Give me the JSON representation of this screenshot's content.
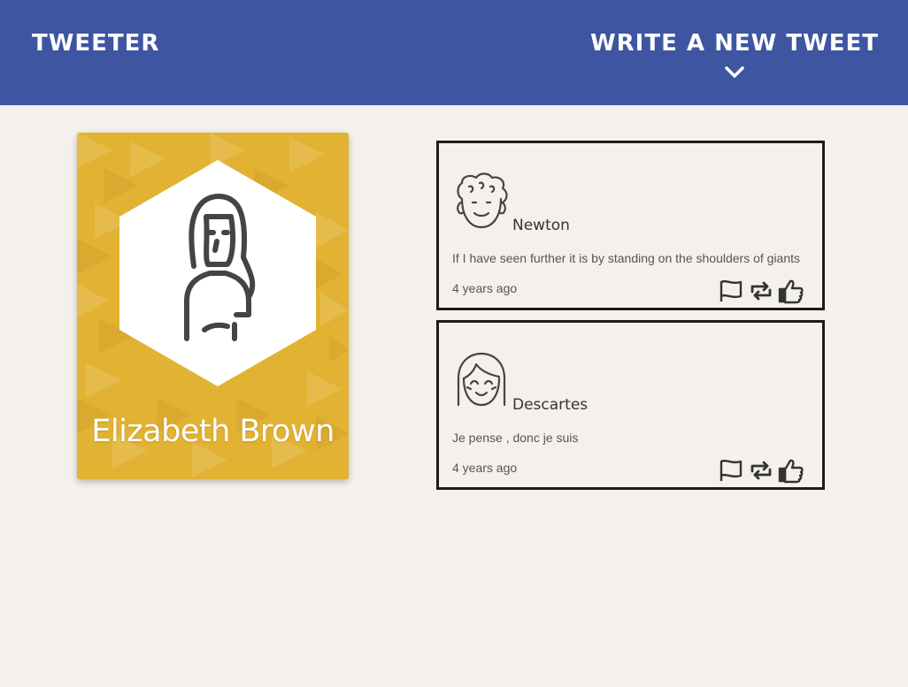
{
  "header": {
    "brand": "Tweeter",
    "compose_label": "Write a new tweet"
  },
  "profile": {
    "name": "Elizabeth Brown"
  },
  "tweets": [
    {
      "author": "Newton",
      "text": "If I have seen further it is by standing on the shoulders of giants",
      "time": "4 years ago"
    },
    {
      "author": "Descartes",
      "text": "Je pense , donc je suis",
      "time": "4 years ago"
    }
  ],
  "colors": {
    "nav": "#3e55a1",
    "card": "#e2b233",
    "background": "#f4f1ec"
  }
}
